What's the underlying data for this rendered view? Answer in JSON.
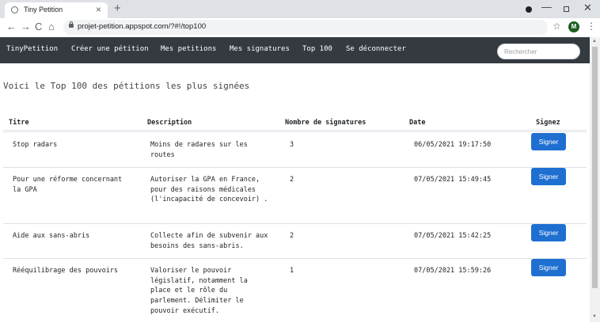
{
  "browser": {
    "tab_title": "Tiny Petition",
    "new_tab_label": "+",
    "url": "projet-petition.appspot.com/?#!/top100",
    "profile_initial": "M"
  },
  "navbar": {
    "brand": "TinyPetition",
    "links": [
      "Créer une pétition",
      "Mes petitions",
      "Mes signatures",
      "Top 100",
      "Se déconnecter"
    ],
    "search_placeholder": "Rechercher"
  },
  "page": {
    "title": "Voici le Top 100 des pétitions les plus signées"
  },
  "table": {
    "headers": [
      "Titre",
      "Description",
      "Nombre de signatures",
      "Date",
      "Signez"
    ],
    "rows": [
      {
        "title": "Stop radars",
        "description": "Moins de radares sur les routes",
        "count": "3",
        "date": "06/05/2021 19:17:50",
        "button": "Signer"
      },
      {
        "title": "Pour une réforme concernant la GPA",
        "description": "Autoriser la GPA en France, pour des raisons médicales (l'incapacité de concevoir) .",
        "count": "2",
        "date": "07/05/2021 15:49:45",
        "button": "Signer"
      },
      {
        "title": "Aide aux sans-abris",
        "description": "Collecte afin de subvenir aux besoins des sans-abris.",
        "count": "2",
        "date": "07/05/2021 15:42:25",
        "button": "Signer"
      },
      {
        "title": "Rééquilibrage des pouvoirs",
        "description": "Valoriser le pouvoir législatif, notamment la place et le rôle du parlement. Délimiter le pouvoir exécutif.",
        "count": "1",
        "date": "07/05/2021 15:59:26",
        "button": "Signer"
      }
    ]
  },
  "icons": {
    "back": "arrow-left-icon",
    "forward": "arrow-right-icon",
    "reload": "reload-icon",
    "home": "home-icon",
    "lock": "lock-icon",
    "star": "star-icon",
    "menu": "kebab-menu-icon"
  },
  "colors": {
    "navbar": "#343a40",
    "button": "#1f6fd1"
  }
}
